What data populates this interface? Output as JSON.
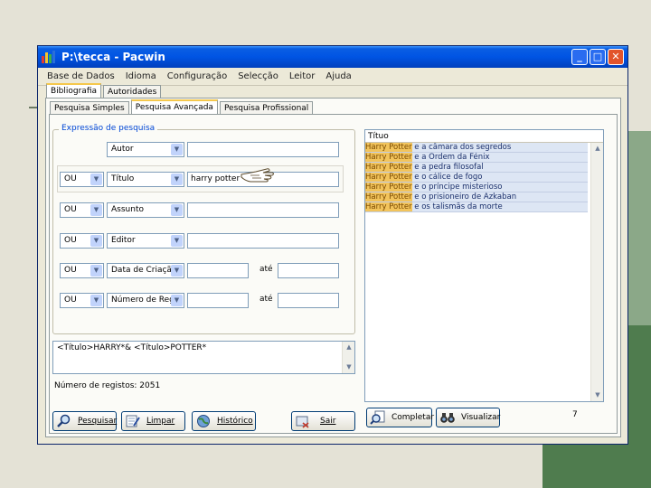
{
  "window": {
    "title": "P:\\tecca - Pacwin",
    "buttons": [
      "_",
      "□",
      "✕"
    ]
  },
  "menu": [
    "Base de Dados",
    "Idioma",
    "Configuração",
    "Selecção",
    "Leitor",
    "Ajuda"
  ],
  "main_tabs": [
    "Bibliografia",
    "Autoridades"
  ],
  "sub_tabs": [
    "Pesquisa Simples",
    "Pesquisa Avançada",
    "Pesquisa Profissional"
  ],
  "search": {
    "legend": "Expressão de pesquisa",
    "rows": [
      {
        "operator": "",
        "field": "Autor",
        "value": ""
      },
      {
        "operator": "OU",
        "field": "Título",
        "value": "harry potter"
      },
      {
        "operator": "OU",
        "field": "Assunto",
        "value": ""
      },
      {
        "operator": "OU",
        "field": "Editor",
        "value": ""
      },
      {
        "operator": "OU",
        "field": "Data de Criação",
        "value": "",
        "to_label": "até"
      },
      {
        "operator": "OU",
        "field": "Número de Reg",
        "value": "",
        "to_label": "até"
      }
    ],
    "expression": "<Título>HARRY*& <Título>POTTER*",
    "count_label": "Número de registos: 2051"
  },
  "buttons": {
    "pesquisar": "Pesquisar",
    "limpar": "Limpar",
    "historico": "Histórico",
    "sair": "Sair",
    "completar": "Completar",
    "visualizar": "Visualizar"
  },
  "results": {
    "header": "Títuo",
    "rows": [
      {
        "hl": "Harry Potter",
        "rest": " e a câmara dos segredos"
      },
      {
        "hl": "Harry Potter",
        "rest": " e a Ordem da Fénix"
      },
      {
        "hl": "Harry Potter",
        "rest": " e a pedra filosofal"
      },
      {
        "hl": "Harry Potter",
        "rest": " e o cálice de fogo"
      },
      {
        "hl": "Harry Potter",
        "rest": " e o príncipe misterioso"
      },
      {
        "hl": "Harry Potter",
        "rest": " e o prisioneiro de Azkaban"
      },
      {
        "hl": "Harry Potter",
        "rest": " e os talismãs da morte"
      }
    ]
  },
  "page_number": "7",
  "icons": {
    "app": "bar-chart-icon",
    "pesquisar": "magnifier-icon",
    "limpar": "eraser-pen-icon",
    "historico": "globe-icon",
    "sair": "exit-door-icon",
    "completar": "magnifier-doc-icon",
    "visualizar": "binoculars-icon",
    "pointer": "hand-pointer-icon"
  },
  "colors": {
    "titlebar": "#0054e3",
    "highlight": "#f2c45c",
    "slide_green": "#4f7c4e"
  }
}
